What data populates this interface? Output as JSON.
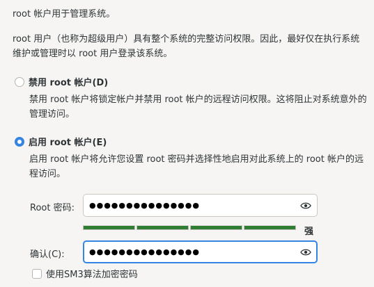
{
  "intro": {
    "line1": "root 帐户用于管理系统。",
    "line2": "root 用户（也称为超级用户）具有整个系统的完整访问权限。因此，最好仅在执行系统维护或管理时以 root 用户登录该系统。"
  },
  "options": {
    "disable": {
      "label": "禁用 root 帐户(D)",
      "description": "禁用 root 帐户将锁定帐户并禁用 root 帐户的远程访问权限。这将阻止对系统意外的管理访问。",
      "selected": false
    },
    "enable": {
      "label": "启用 root 帐户(E)",
      "description": "启用 root 帐户将允许您设置 root 密码并选择性地启用对此系统上的 root 帐户的远程访问。",
      "selected": true
    }
  },
  "password": {
    "label": "Root 密码:",
    "value": "●●●●●●●●●●●●●●●",
    "strength_label": "强",
    "strength_fraction": 1.0,
    "icon": "eye-icon"
  },
  "confirm": {
    "label": "确认(C):",
    "value": "●●●●●●●●●●●●●●●",
    "icon": "eye-icon"
  },
  "sm3": {
    "label": "使用SM3算法加密密码",
    "checked": false
  },
  "colors": {
    "accent": "#3584e4",
    "strength_bar": "#2e7d32"
  }
}
